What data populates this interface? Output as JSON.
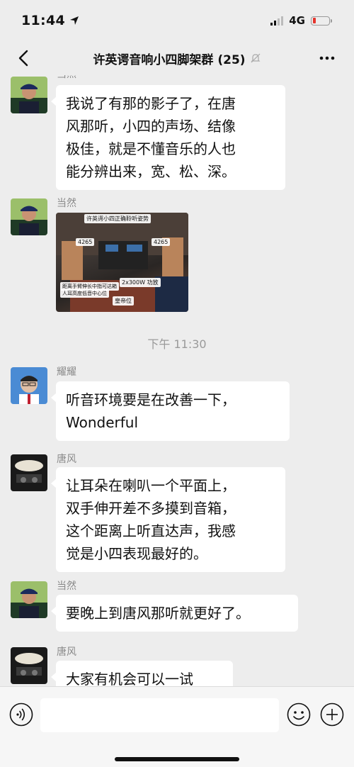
{
  "status_bar": {
    "time": "11:44",
    "network": "4G"
  },
  "nav": {
    "title": "许英谔音响小四脚架群 (25)"
  },
  "messages": [
    {
      "sender": "当然",
      "text": [
        "我说了有那的影子了，在唐",
        "风那听，小四的声场、结像",
        "极佳，就是不懂音乐的人也",
        "能分辨出来，宽、松、深。"
      ]
    },
    {
      "sender": "当然",
      "image": {
        "title": "许英谔小四正确聆听姿势",
        "label_left": "4265",
        "label_right": "4265",
        "label_amp": "2x300W 功放",
        "label_note_1": "距离手臂伸长中指可达箱",
        "label_note_2": "人耳高度低音中心位",
        "label_seat": "皇帝位"
      }
    },
    {
      "timestamp": "下午 11:30"
    },
    {
      "sender": "耀耀",
      "text": [
        "听音环境要是在改善一下，",
        "Wonderful"
      ]
    },
    {
      "sender": "唐风",
      "text": [
        "让耳朵在喇叭一个平面上，",
        "双手伸开差不多摸到音箱，",
        "这个距离上听直达声，我感",
        "觉是小四表现最好的。"
      ]
    },
    {
      "sender": "当然",
      "text": [
        "要晚上到唐风那听就更好了。"
      ]
    },
    {
      "sender": "唐风",
      "text": [
        "大家有机会可以一试"
      ]
    }
  ]
}
